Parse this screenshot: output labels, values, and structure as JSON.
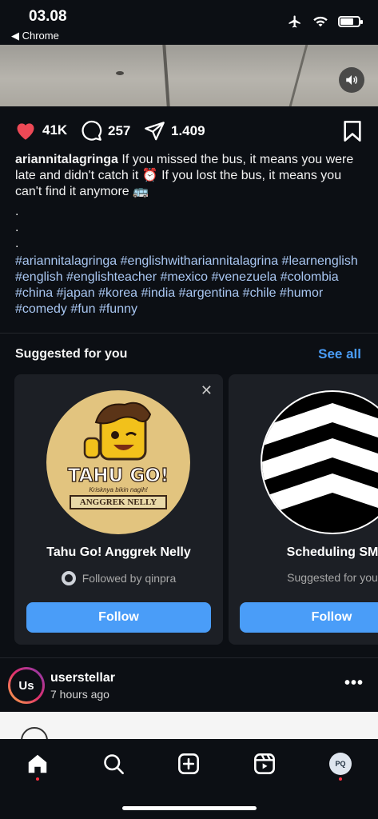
{
  "status_bar": {
    "time": "03.08",
    "back_label": "◀ Chrome"
  },
  "post": {
    "likes": "41K",
    "comments": "257",
    "shares": "1.409",
    "username": "ariannitalagringa",
    "caption": " If you missed the bus, it means you were late and didn't catch it ⏰ If you lost the bus, it means you can't find it anymore 🚌",
    "dots": [
      ".",
      ".",
      "."
    ],
    "hashtags": "#ariannitalagringa #englishwithariannitalagrina #learnenglish #english #englishteacher #mexico #venezuela #colombia #china #japan #korea #india #argentina #chile #humor #comedy #fun #funny"
  },
  "suggested": {
    "title": "Suggested for you",
    "see_all": "See all",
    "cards": [
      {
        "name": "Tahu Go! Anggrek Nelly",
        "subtitle": "Followed by qinpra",
        "button": "Follow",
        "logo_main": "TAHU GO!",
        "logo_tagline": "Krisknya bikin nagih!",
        "logo_banner": "ANGGREK NELLY",
        "close": "✕"
      },
      {
        "name": "Scheduling SM",
        "subtitle": "Suggested for you",
        "button": "Follow"
      }
    ]
  },
  "next_post": {
    "avatar_initials": "Us",
    "username": "userstellar",
    "time": "7 hours ago",
    "more": "•••"
  },
  "tabbar": {
    "profile_initials": "PQ"
  },
  "colors": {
    "accent": "#4a9df8",
    "like": "#ed4956",
    "background": "#0c0f14",
    "hashtag": "#a9c7f2"
  }
}
